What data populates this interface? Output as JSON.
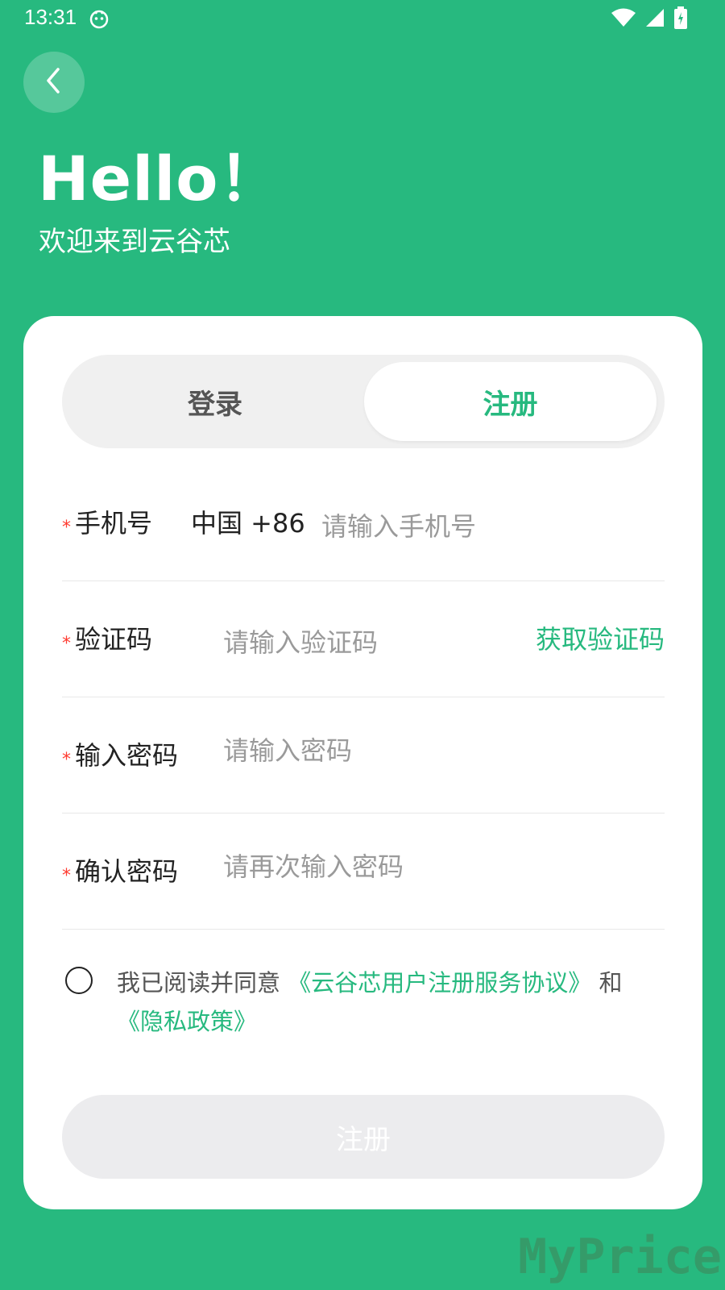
{
  "status": {
    "time": "13:31"
  },
  "header": {
    "title": "Hello！",
    "subtitle": "欢迎来到云谷芯"
  },
  "tabs": [
    {
      "label": "登录",
      "active": false
    },
    {
      "label": "注册",
      "active": true
    }
  ],
  "form": {
    "phone": {
      "label": "手机号",
      "country": "中国 +86",
      "placeholder": "请输入手机号"
    },
    "code": {
      "label": "验证码",
      "placeholder": "请输入验证码",
      "action": "获取验证码"
    },
    "password": {
      "label": "输入密码",
      "placeholder": "请输入密码"
    },
    "confirm": {
      "label": "确认密码",
      "placeholder": "请再次输入密码"
    },
    "required_mark": "*"
  },
  "agreement": {
    "prefix": "我已阅读并同意",
    "link1": "《云谷芯用户注册服务协议》",
    "and": "和",
    "link2": "《隐私政策》"
  },
  "submit_label": "注册",
  "watermark": "MyPrice",
  "colors": {
    "brand": "#27b97f",
    "required": "#ff3b30",
    "disabled_button": "#ececee"
  },
  "icons": [
    "back-arrow-icon",
    "wifi-icon",
    "signal-icon",
    "battery-icon",
    "status-face-icon"
  ]
}
